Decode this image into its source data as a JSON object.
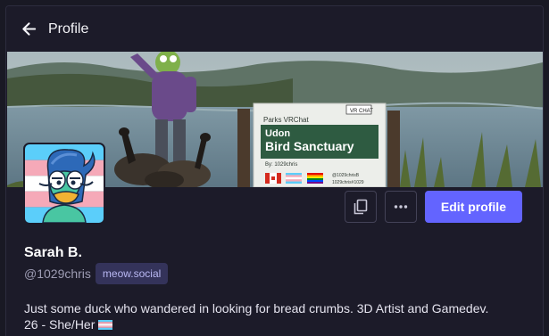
{
  "header": {
    "title": "Profile",
    "back_icon": "arrow-left-icon"
  },
  "banner": {
    "sign": {
      "brand": "Parks VRChat",
      "badge": "VR CHAT",
      "line1": "Udon",
      "line2": "Bird Sanctuary",
      "credit": "By: 1029chris",
      "social1": "@1029chrisB",
      "social2": "1029chris#1029"
    }
  },
  "avatar": {
    "description_icon": "duck-avatar-icon"
  },
  "actions": {
    "copy_icon": "copy-icon",
    "more_icon": "ellipsis-icon",
    "edit_label": "Edit profile"
  },
  "profile": {
    "display_name": "Sarah B.",
    "handle": "@1029chris",
    "domain": "meow.social",
    "bio_line1": "Just some duck who wandered in looking for bread crumbs. 3D Artist and Gamedev.",
    "bio_line2": "26 - She/Her"
  },
  "colors": {
    "accent": "#6364ff",
    "background": "#1c1b29",
    "badge_bg": "#34335a"
  }
}
